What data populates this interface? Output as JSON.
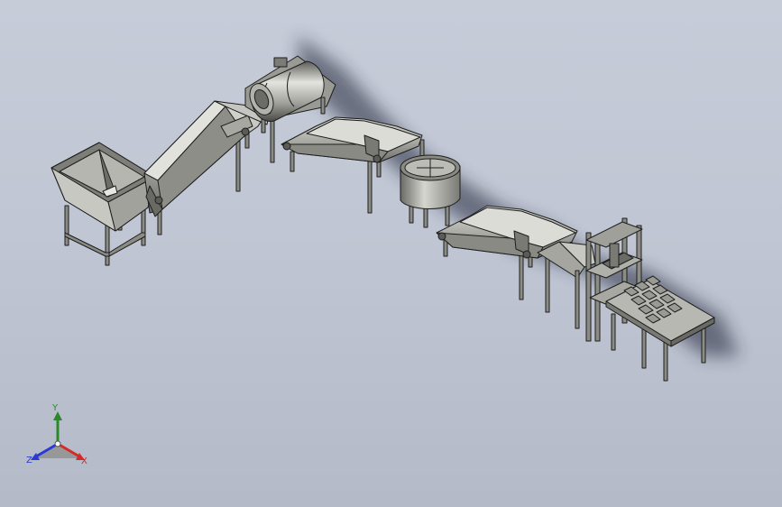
{
  "viewport": {
    "background_top": "#c6ccd8",
    "background_bottom": "#b4bac8"
  },
  "model": {
    "shading_color": "#8c8c86",
    "highlight_color": "#d8d8d2",
    "edge_color": "#1e1e1e"
  },
  "triad": {
    "x_label": "X",
    "y_label": "Y",
    "z_label": "Z",
    "x_color": "#d42a2a",
    "y_color": "#2a8a2a",
    "z_color": "#2a3ad4"
  }
}
